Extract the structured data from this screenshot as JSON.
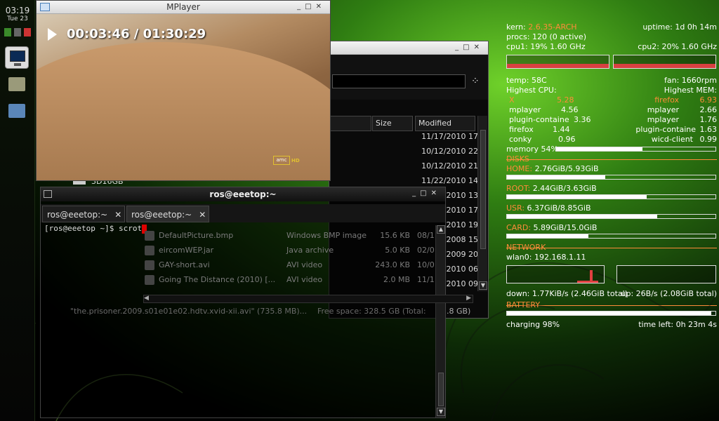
{
  "dock": {
    "time": "03:19",
    "date": "Tue 23"
  },
  "mplayer": {
    "title": "MPlayer",
    "osd_time": "00:03:46 / 01:30:29",
    "logo": "amc",
    "logo_hd": "HD"
  },
  "file_manager": {
    "columns": [
      "Size",
      "Modified"
    ],
    "modified": [
      "11/17/2010 17",
      "10/12/2010 22",
      "10/12/2010 21",
      "11/22/2010 14",
      "2010 13",
      "2010 17",
      "2010 19",
      "2008 15",
      "2009 20",
      "2010 06",
      "2010 09"
    ],
    "status_right": "5.8 GB)",
    "sidebar_item": "3D16GB"
  },
  "file_list": {
    "rows": [
      {
        "name": "DefaultPicture.bmp",
        "type": "Windows BMP image",
        "size": "15.6 KB",
        "modified": "08/1"
      },
      {
        "name": "eircomWEP.jar",
        "type": "Java archive",
        "size": "5.0 KB",
        "modified": "02/0"
      },
      {
        "name": "GAY-short.avi",
        "type": "AVI video",
        "size": "243.0 KB",
        "modified": "10/0"
      },
      {
        "name": "Going The Distance (2010) [...",
        "type": "AVI video",
        "size": "2.0 MB",
        "modified": "11/1"
      }
    ],
    "status_left": "\"the.prisoner.2009.s01e01e02.hdtv.xvid-xii.avi\" (735.8 MB)...",
    "status_right": "Free space: 328.5 GB (Total:"
  },
  "terminal": {
    "title": "ros@eeetop:~",
    "tabs": [
      "ros@eeetop:~",
      "ros@eeetop:~"
    ],
    "prompt": "[ros@eeetop ~]$ scrot"
  },
  "conky": {
    "kern_label": "kern:",
    "kern": "2.6.35-ARCH",
    "uptime": "uptime: 1d 0h 14m",
    "procs": "procs: 120 (0 active)",
    "cpu1": "cpu1: 19% 1.60 GHz",
    "cpu2": "cpu2: 20% 1.60 GHz",
    "temp": "temp: 58C",
    "fan": "fan: 1660rpm",
    "highest_cpu": "Highest CPU:",
    "highest_mem": "Highest MEM:",
    "cpu_procs": [
      {
        "name": "X",
        "value": "5.28"
      },
      {
        "name": "mplayer",
        "value": "4.56"
      },
      {
        "name": "plugin-containe",
        "value": "3.36"
      },
      {
        "name": "firefox",
        "value": "1.44"
      },
      {
        "name": "conky",
        "value": "0.96"
      }
    ],
    "mem_procs": [
      {
        "name": "firefox",
        "value": "6.93"
      },
      {
        "name": "mplayer",
        "value": "2.66"
      },
      {
        "name": "mplayer",
        "value": "1.76"
      },
      {
        "name": "plugin-containe",
        "value": "1.63"
      },
      {
        "name": "wicd-client",
        "value": "0.99"
      }
    ],
    "memory": "memory 54%",
    "memory_pct": 0.54,
    "disks_header": "DISKS",
    "disks": [
      {
        "label": "HOME:",
        "value": "2.76GiB/5.93GiB",
        "pct": 0.47
      },
      {
        "label": "ROOT:",
        "value": "2.44GiB/3.63GiB",
        "pct": 0.67
      },
      {
        "label": "USR:",
        "value": "6.37GiB/8.85GiB",
        "pct": 0.72
      },
      {
        "label": "CARD:",
        "value": "5.89GiB/15.0GiB",
        "pct": 0.39
      }
    ],
    "network_header": "NETWORK",
    "wlan": "wlan0: 192.168.1.11",
    "down": "down: 1.77KiB/s (2.46GiB total)",
    "up": "up: 26B/s (2.08GiB total)",
    "battery_header": "BATTERY",
    "battery_pct": 0.98,
    "charging": "charging 98%",
    "time_left": "time left: 0h 23m 4s"
  },
  "colors": {
    "conky_accent": "#ff8c3a",
    "graph_red": "#e04040"
  }
}
